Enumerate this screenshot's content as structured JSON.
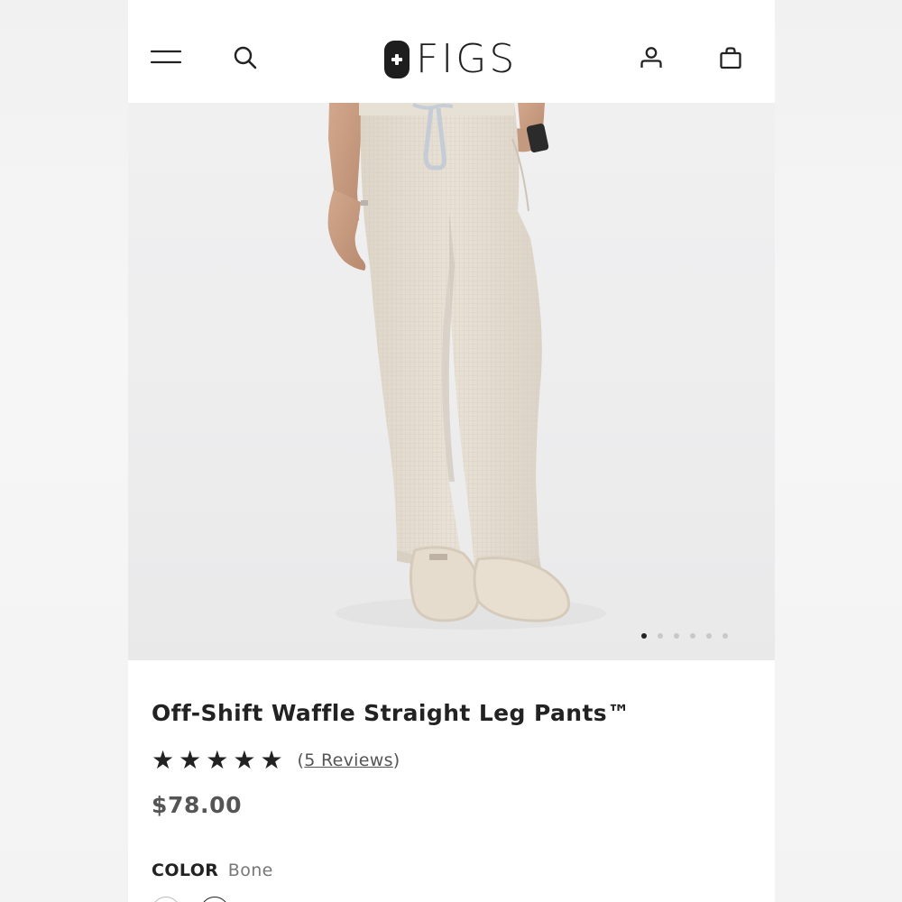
{
  "brand": {
    "name": "FIGS"
  },
  "header": {
    "icons": [
      "menu-icon",
      "search-icon",
      "account-icon",
      "bag-icon"
    ]
  },
  "gallery": {
    "image_count": 6,
    "active_index": 0
  },
  "product": {
    "title": "Off-Shift Waffle Straight Leg Pants™",
    "stars": [
      "★",
      "★",
      "★",
      "★",
      "★"
    ],
    "rating": 5,
    "reviews_open": "(",
    "reviews_label": "5 Reviews",
    "reviews_close": ")",
    "price": "$78.00",
    "color_label": "COLOR",
    "color_value": "Bone"
  },
  "colors": {
    "text": "#222222",
    "muted": "#777777",
    "pants": "#e4ddd1",
    "background": "#ffffff"
  }
}
